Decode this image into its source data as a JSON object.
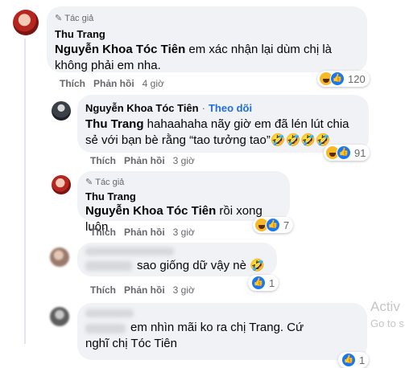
{
  "comments": [
    {
      "author_badge": "Tác giả",
      "name": "Thu Trang",
      "text_mention": "Nguyễn Khoa Tóc Tiên",
      "text": " em xác nhận lại dùm chị là không phải em nha.",
      "like": "Thích",
      "reply": "Phản hồi",
      "time": "4 giờ",
      "reaction_count": "120"
    },
    {
      "name": "Nguyễn Khoa Tóc Tiên",
      "follow": "Theo dõi",
      "text_mention": "Thu Trang",
      "text": " hahaahaha nãy giờ em đã lén lút chia sẻ với bạn bè rằng “tao tưởng tao”🤣🤣🤣🤣",
      "like": "Thích",
      "reply": "Phản hồi",
      "time": "3 giờ",
      "reaction_count": "91"
    },
    {
      "author_badge": "Tác giả",
      "name": "Thu Trang",
      "text_mention": "Nguyễn Khoa Tóc Tiên",
      "text": " rồi xong luôn",
      "like": "Thích",
      "reply": "Phản hồi",
      "time": "3 giờ",
      "reaction_count": "7"
    },
    {
      "text": "sao giống dữ vậy nè 🤣",
      "like": "Thích",
      "reply": "Phản hồi",
      "time": "3 giờ",
      "reaction_count": "1"
    },
    {
      "text": "em nhìn mãi ko ra chị Trang. Cứ nghĩ chị Tóc Tiên",
      "reaction_count": "1"
    }
  ],
  "watermark": {
    "line1": "Activ",
    "line2": "Go to s"
  },
  "colors": {
    "bubble": "#f0f2f5",
    "like_blue": "#1877f2",
    "follow_blue": "#216fdb",
    "muted": "#65676b"
  }
}
